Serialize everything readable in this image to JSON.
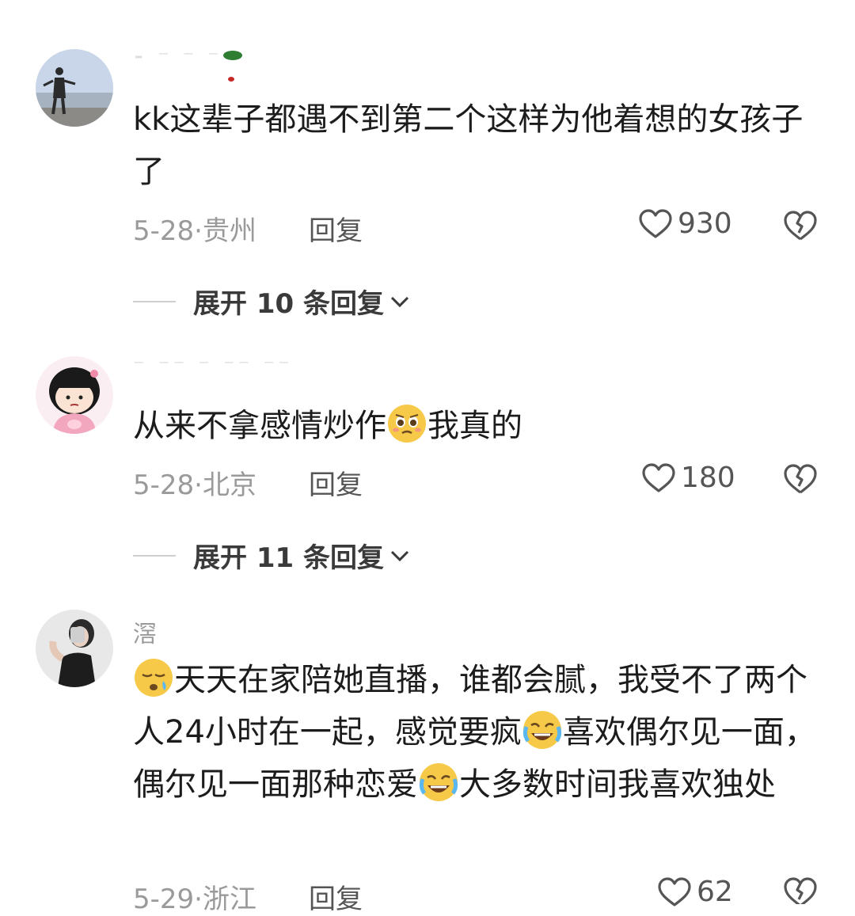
{
  "comments": [
    {
      "body_text": "kk这辈子都遇不到第二个这样为他着想的女孩子了",
      "date": "5-28",
      "location": "贵州",
      "reply_label": "回复",
      "likes": "930",
      "expand_label": "展开 10 条回复"
    },
    {
      "body_before": "从来不拿感情炒作",
      "body_after": "我真的",
      "date": "5-28",
      "location": "北京",
      "reply_label": "回复",
      "likes": "180",
      "expand_label": "展开 11 条回复"
    },
    {
      "username": "滘",
      "body_p1": "天天在家陪她直播，谁都会腻，我受不了两个人24小时在一起，感觉要疯",
      "body_p2": "喜欢偶尔见一面，偶尔见一面那种恋爱",
      "body_p3": "大多数时间我喜欢独处",
      "date": "5-29",
      "location": "浙江",
      "reply_label": "回复",
      "likes": "62"
    }
  ],
  "icons": {
    "like": "heart-outline-icon",
    "dislike": "broken-heart-icon",
    "expand": "chevron-down-icon",
    "emoji_pleading": "pleading-face-emoji",
    "emoji_sleepy": "sleepy-face-emoji",
    "emoji_rofl": "rolling-laughing-emoji"
  }
}
